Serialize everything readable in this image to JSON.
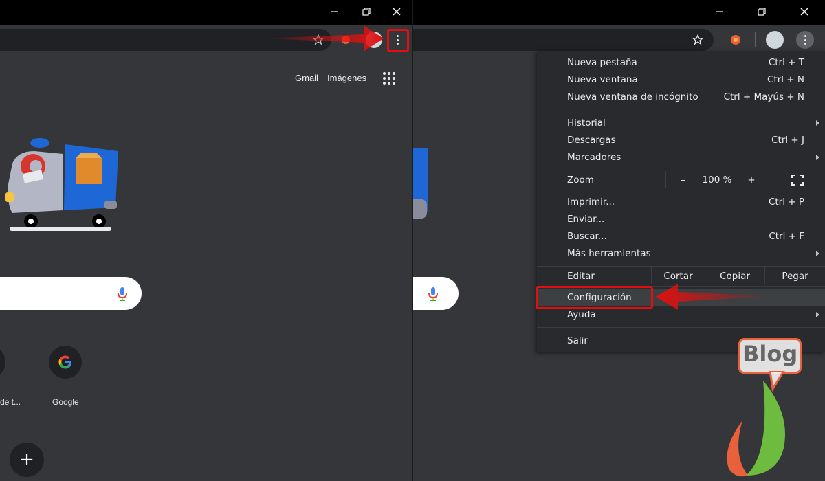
{
  "left_panel": {
    "header_links": {
      "gmail": "Gmail",
      "images": "Imágenes"
    },
    "shortcuts": [
      {
        "label": "de t..."
      },
      {
        "label": "Google",
        "icon": "google-g-icon"
      }
    ],
    "add_shortcut": "+"
  },
  "menu": {
    "items": {
      "new_tab": {
        "label": "Nueva pestaña",
        "shortcut": "Ctrl + T"
      },
      "new_window": {
        "label": "Nueva ventana",
        "shortcut": "Ctrl + N"
      },
      "incognito": {
        "label": "Nueva ventana de incógnito",
        "shortcut": "Ctrl + Mayús + N"
      },
      "history": {
        "label": "Historial"
      },
      "downloads": {
        "label": "Descargas",
        "shortcut": "Ctrl + J"
      },
      "bookmarks": {
        "label": "Marcadores"
      },
      "print": {
        "label": "Imprimir...",
        "shortcut": "Ctrl + P"
      },
      "cast": {
        "label": "Enviar..."
      },
      "find": {
        "label": "Buscar...",
        "shortcut": "Ctrl + F"
      },
      "more_tools": {
        "label": "Más herramientas"
      },
      "settings": {
        "label": "Configuración"
      },
      "help": {
        "label": "Ayuda"
      },
      "exit": {
        "label": "Salir"
      }
    },
    "zoom": {
      "label": "Zoom",
      "minus": "–",
      "value": "100 %",
      "plus": "+"
    },
    "edit": {
      "label": "Editar",
      "cut": "Cortar",
      "copy": "Copiar",
      "paste": "Pegar"
    }
  },
  "watermark": {
    "text": "Blog"
  },
  "colors": {
    "annotation_red": "#e01010",
    "menu_bg": "#292a2d",
    "page_bg": "#35363a",
    "highlight": "#3c4043"
  }
}
